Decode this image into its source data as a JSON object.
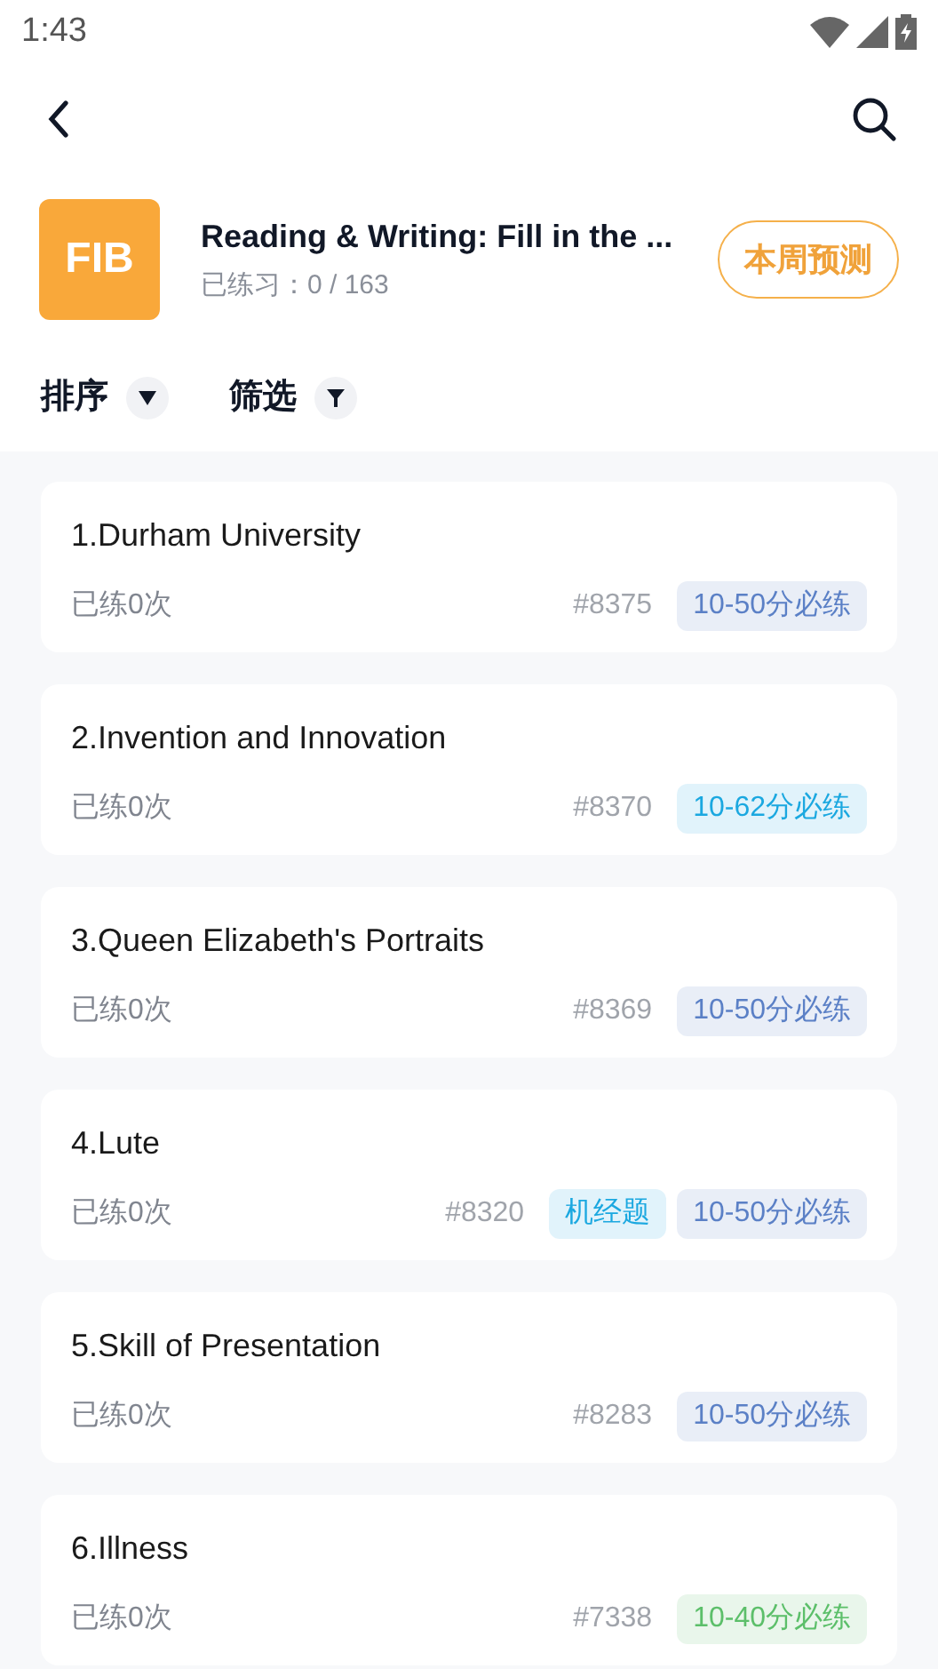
{
  "status_bar": {
    "time": "1:43"
  },
  "header": {
    "logo": "FIB",
    "title": "Reading & Writing: Fill in the ...",
    "progress": "已练习：0 / 163",
    "action": "本周预测"
  },
  "filters": [
    {
      "label": "排序",
      "kind": "sort"
    },
    {
      "label": "筛选",
      "kind": "filter"
    }
  ],
  "items": [
    {
      "title": "1.Durham University",
      "practiced": "已练0次",
      "number": "#8375",
      "tags": [
        {
          "label": "10-50分必练",
          "color": "#5b80c6"
        }
      ]
    },
    {
      "title": "2.Invention and Innovation",
      "practiced": "已练0次",
      "number": "#8370",
      "tags": [
        {
          "label": "10-62分必练",
          "color": "#1ba8e0"
        }
      ]
    },
    {
      "title": "3.Queen Elizabeth's Portraits",
      "practiced": "已练0次",
      "number": "#8369",
      "tags": [
        {
          "label": "10-50分必练",
          "color": "#5b80c6"
        }
      ]
    },
    {
      "title": "4.Lute",
      "practiced": "已练0次",
      "number": "#8320",
      "tags": [
        {
          "label": "机经题",
          "color": "#1ba8e0"
        },
        {
          "label": "10-50分必练",
          "color": "#5b80c6"
        }
      ]
    },
    {
      "title": "5.Skill of Presentation",
      "practiced": "已练0次",
      "number": "#8283",
      "tags": [
        {
          "label": "10-50分必练",
          "color": "#5b80c6"
        }
      ]
    },
    {
      "title": "6.Illness",
      "practiced": "已练0次",
      "number": "#7338",
      "tags": [
        {
          "label": "10-40分必练",
          "color": "#5cbf6a"
        }
      ]
    }
  ]
}
